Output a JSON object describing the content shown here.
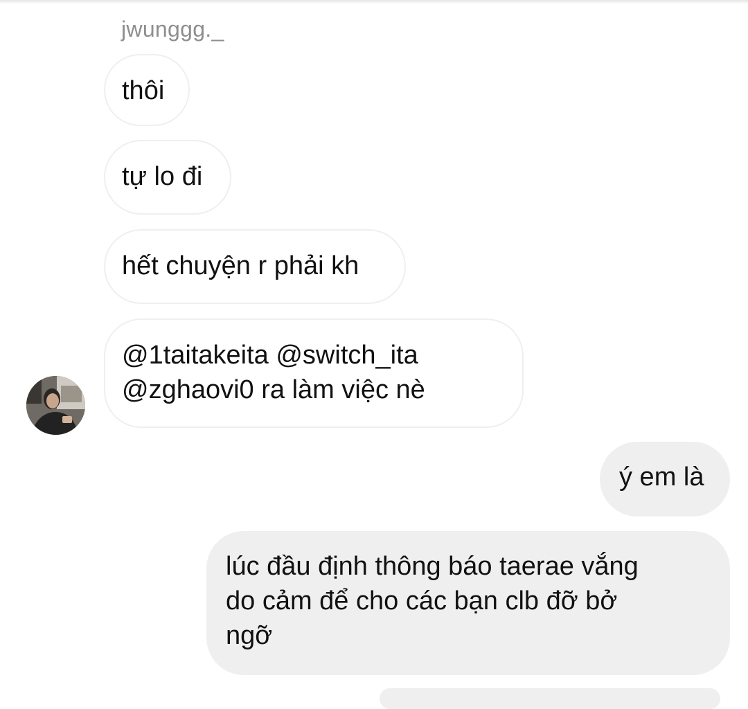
{
  "chat": {
    "sender_name": "jwunggg._",
    "incoming_messages": [
      "thôi",
      "tự lo đi",
      "hết chuyện r phải kh",
      "@1taitakeita @switch_ita",
      "@zghaovi0 ra làm việc nè"
    ],
    "outgoing_messages": [
      "ý em là",
      "lúc đầu định thông báo taerae vắng",
      "do cảm để cho các bạn clb đỡ bở",
      "ngỡ"
    ]
  },
  "colors": {
    "incoming_bubble_bg": "#ffffff",
    "incoming_bubble_border": "#efefef",
    "outgoing_bubble_bg": "#efefef",
    "sender_name": "#8e8e8e",
    "message_text": "#111111"
  },
  "icons": {
    "avatar": "sender-profile-photo"
  }
}
